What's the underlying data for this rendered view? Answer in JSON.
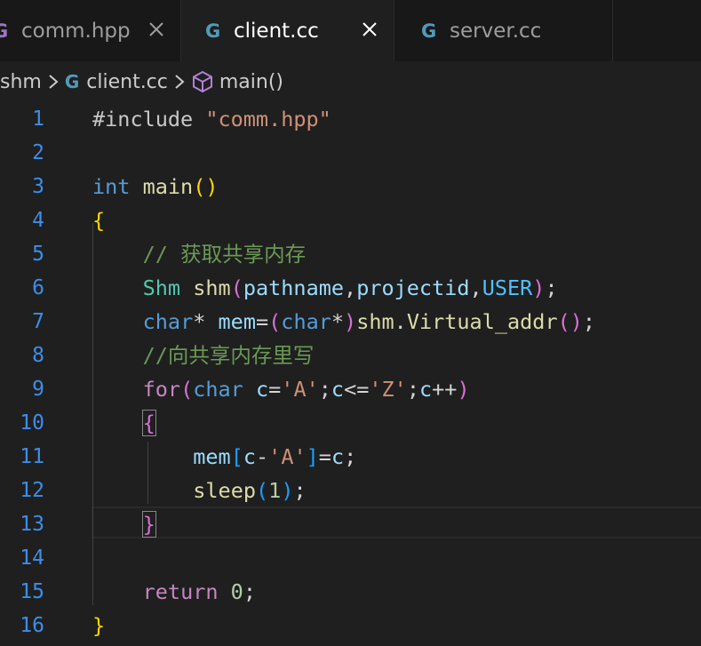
{
  "tabs": [
    {
      "label": "comm.hpp",
      "icon": "c-plus-plus-icon",
      "active": false
    },
    {
      "label": "client.cc",
      "icon": "c-plus-plus-icon",
      "active": true
    },
    {
      "label": "server.cc",
      "icon": "c-plus-plus-icon",
      "active": false
    }
  ],
  "breadcrumb": {
    "folder": "shm",
    "file": "client.cc",
    "symbol": "main()"
  },
  "editor": {
    "language": "cpp",
    "current_line": 13,
    "line_numbers": [
      "1",
      "2",
      "3",
      "4",
      "5",
      "6",
      "7",
      "8",
      "9",
      "10",
      "11",
      "12",
      "13",
      "14",
      "15",
      "16"
    ],
    "lines": [
      "#include \"comm.hpp\"",
      "",
      "int main()",
      "{",
      "    // 获取共享内存",
      "    Shm shm(pathname,projectid,USER);",
      "    char* mem=(char*)shm.Virtual_addr();",
      "    //向共享内存里写",
      "    for(char c='A';c<='Z';c++)",
      "    {",
      "        mem[c-'A']=c;",
      "        sleep(1);",
      "    }",
      "",
      "    return 0;",
      "}"
    ]
  },
  "colors": {
    "background": "#1f1f1f",
    "tab_inactive": "#181818",
    "line_number": "#3b8eea",
    "keyword": "#569cd6",
    "control": "#c586c0",
    "function": "#dcdcaa",
    "type": "#4ec9b0",
    "variable": "#9cdcfe",
    "string": "#ce9178",
    "number": "#b5cea8",
    "comment": "#6a9955"
  }
}
